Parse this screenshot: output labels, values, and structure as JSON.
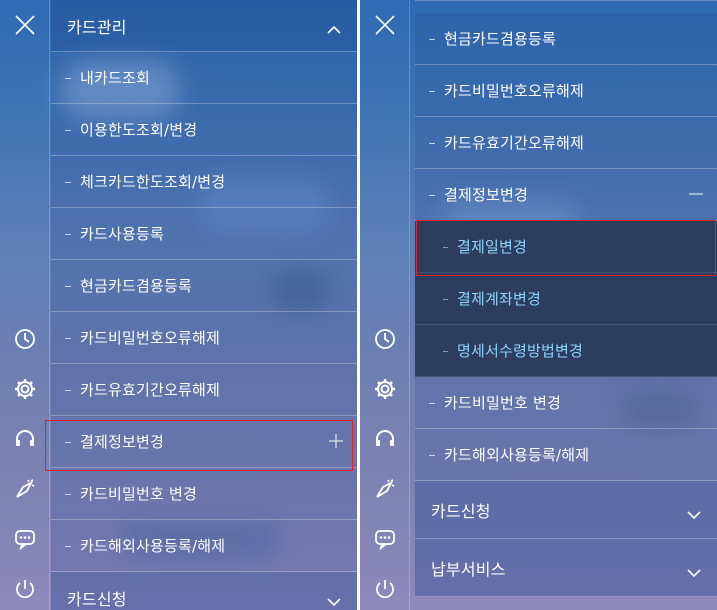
{
  "left": {
    "header": {
      "label": "카드관리"
    },
    "items": [
      "내카드조회",
      "이용한도조회/변경",
      "체크카드한도조회/변경",
      "카드사용등록",
      "현금카드겸용등록",
      "카드비밀번호오류해제",
      "카드유효기간오류해제",
      "결제정보변경",
      "카드비밀번호 변경",
      "카드해외사용등록/해제"
    ],
    "footer": {
      "label": "카드신청"
    }
  },
  "right": {
    "items_top": [
      "현금카드겸용등록",
      "카드비밀번호오류해제",
      "카드유효기간오류해제",
      "결제정보변경"
    ],
    "subsub": [
      "결제일변경",
      "결제계좌변경",
      "명세서수령방법변경"
    ],
    "items_bottom": [
      "카드비밀번호 변경",
      "카드해외사용등록/해제"
    ],
    "headers": [
      "카드신청",
      "납부서비스"
    ]
  },
  "rail_icons": [
    "close-icon",
    "clock-icon",
    "gear-icon",
    "headset-icon",
    "megaphone-icon",
    "chat-icon",
    "power-icon"
  ],
  "colors": {
    "highlight": "#e0222a",
    "subsub_text": "#8fd3ff",
    "subsub_bg": "#2c3d5e"
  }
}
